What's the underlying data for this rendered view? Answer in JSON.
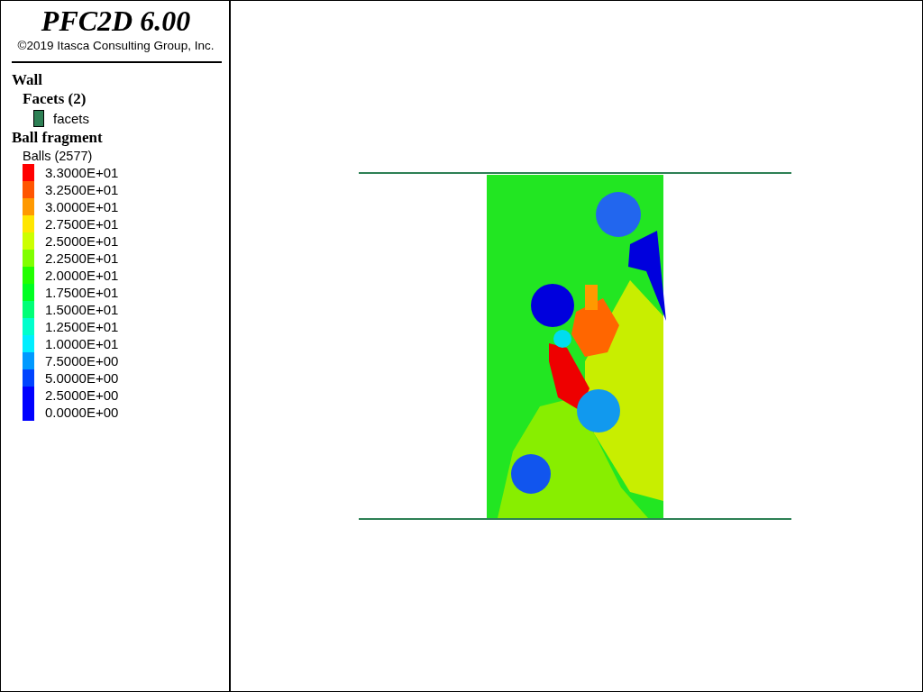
{
  "legend_header": {
    "title": "PFC2D 6.00",
    "copyright": "©2019 Itasca Consulting Group, Inc."
  },
  "legend": {
    "wall": {
      "title": "Wall",
      "group": "Facets (2)",
      "items": [
        {
          "label": "facets",
          "color": "#2e8055"
        }
      ]
    },
    "ball": {
      "title": "Ball fragment",
      "group": "Balls (2577)",
      "items": [
        {
          "label": "3.3000E+01",
          "color": "#ff0000"
        },
        {
          "label": "3.2500E+01",
          "color": "#ff5500"
        },
        {
          "label": "3.0000E+01",
          "color": "#ff9900"
        },
        {
          "label": "2.7500E+01",
          "color": "#ffe600"
        },
        {
          "label": "2.5000E+01",
          "color": "#ccff00"
        },
        {
          "label": "2.2500E+01",
          "color": "#80ff00"
        },
        {
          "label": "2.0000E+01",
          "color": "#22ff00"
        },
        {
          "label": "1.7500E+01",
          "color": "#00ff22"
        },
        {
          "label": "1.5000E+01",
          "color": "#00ff77"
        },
        {
          "label": "1.2500E+01",
          "color": "#00ffcc"
        },
        {
          "label": "1.0000E+01",
          "color": "#00eeff"
        },
        {
          "label": "7.5000E+00",
          "color": "#0099ff"
        },
        {
          "label": "5.0000E+00",
          "color": "#0044ff"
        },
        {
          "label": "2.5000E+00",
          "color": "#0000ff"
        },
        {
          "label": "0.0000E+00",
          "color": "#0000ff"
        }
      ]
    }
  }
}
